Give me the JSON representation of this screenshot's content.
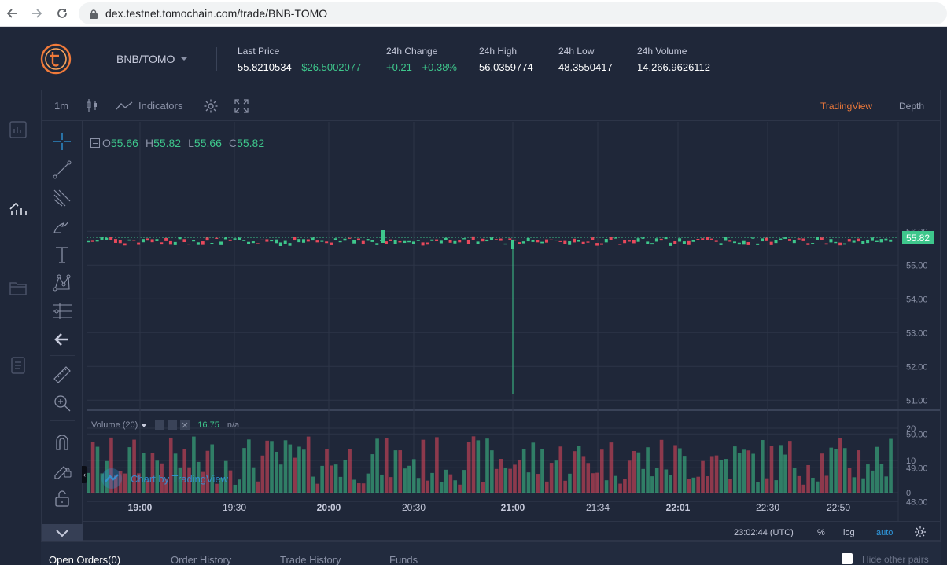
{
  "browser": {
    "url": "dex.testnet.tomochain.com/trade/BNB-TOMO"
  },
  "header": {
    "pair": "BNB/TOMO",
    "stats": [
      {
        "label": "Last Price",
        "value": "55.8210534",
        "extra": "$26.5002077"
      },
      {
        "label": "24h Change",
        "value": "+0.21",
        "extra": "+0.38%"
      },
      {
        "label": "24h High",
        "value": "56.0359774"
      },
      {
        "label": "24h Low",
        "value": "48.3550417"
      },
      {
        "label": "24h Volume",
        "value": "14,266.9626112"
      }
    ]
  },
  "toolbar": {
    "interval": "1m",
    "indicators": "Indicators",
    "tradingview": "TradingView",
    "depth": "Depth"
  },
  "legend": {
    "o_label": "O",
    "o": "55.66",
    "h_label": "H",
    "h": "55.82",
    "l_label": "L",
    "l": "55.66",
    "c_label": "C",
    "c": "55.82"
  },
  "price_axis": {
    "ticks": [
      "56.00",
      "55.00",
      "54.00",
      "53.00",
      "52.00",
      "51.00",
      "50.00",
      "49.00",
      "48.00"
    ],
    "current": "55.82"
  },
  "volume": {
    "label": "Volume (20)",
    "value": "16.75",
    "na": "n/a",
    "ticks": [
      "20",
      "10",
      "0"
    ]
  },
  "watermark": "Chart by TradingView",
  "time_axis": {
    "ticks": [
      "19:00",
      "19:30",
      "20:00",
      "20:30",
      "21:00",
      "21:34",
      "22:01",
      "22:30",
      "22:50"
    ],
    "bold": [
      true,
      false,
      true,
      false,
      true,
      false,
      true,
      false,
      false
    ]
  },
  "footer": {
    "clock": "23:02:44 (UTC)",
    "percent": "%",
    "log": "log",
    "auto": "auto"
  },
  "bottom_tabs": [
    "Open Orders(0)",
    "Order History",
    "Trade History",
    "Funds"
  ],
  "hide_other_pairs": "Hide other pairs",
  "colors": {
    "up": "#3ec78c",
    "down": "#e8495c",
    "accent": "#f07a3a",
    "link": "#2f9ae0"
  }
}
